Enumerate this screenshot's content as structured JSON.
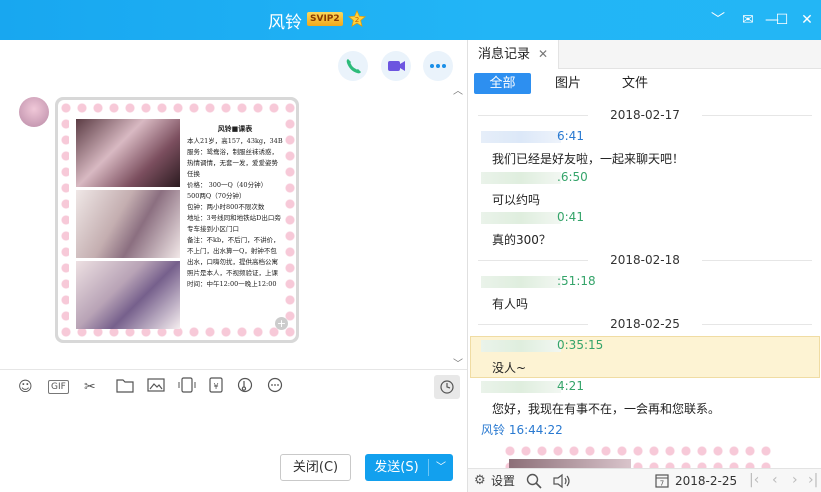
{
  "window": {
    "title": "风铃",
    "vip_badge": "SVIP2",
    "level_badge": "2",
    "controls": {
      "dropdown": "﹀",
      "skin": "✉",
      "minimize": "—",
      "maximize": "☐",
      "close": "✕"
    }
  },
  "chat": {
    "card": {
      "title": "风铃■课表",
      "lines": [
        "本人21岁，高157，43kg，34B",
        "服务：鸳鸯浴，制服丝袜诱惑，热情调情，无套一发，爱爱姿势任换",
        "价格： 300一Q（40分钟）",
        "500两Q（70分钟）",
        "包钟：两小时800不限次数",
        "地址：3号线同和地铁站D出口旁专车接到小区门口",
        "备注：不kb，不后门，不讲价，不上门，出水算一Q，射钟不包出水，口嗨勿扰，提供高档公寓",
        "照片是本人，不视频验证，上课时间：中午12:00一晚上12:00"
      ]
    },
    "toolbar_icons": [
      "smile-icon",
      "gif-icon",
      "scissors-icon",
      "folder-icon",
      "image-icon",
      "screen-icon",
      "red-packet-icon",
      "music-icon",
      "more-icon"
    ],
    "toolbar_gif_label": "GIF",
    "buttons": {
      "close": "关闭(C)",
      "send": "发送(S)"
    }
  },
  "history": {
    "tab_label": "消息记录",
    "filters": [
      "全部",
      "图片",
      "文件"
    ],
    "groups": [
      {
        "date": "2018-02-17"
      },
      {
        "date": "2018-02-18"
      },
      {
        "date": "2018-02-25"
      }
    ],
    "messages": [
      {
        "time": "6:41",
        "text": "我们已经是好友啦，一起来聊天吧！"
      },
      {
        "time": ".6:50",
        "text": "可以约吗"
      },
      {
        "time": "0:41",
        "text": "真的300？"
      },
      {
        "time": ":51:18",
        "text": "有人吗"
      },
      {
        "time": "0:35:15",
        "text": "没人~"
      },
      {
        "time": "4:21",
        "text": "您好，我现在有事不在，一会再和您联系。"
      }
    ],
    "self_header": "风铃 16:44:22",
    "bottom": {
      "settings": "设置",
      "date": "2018-2-25"
    }
  }
}
